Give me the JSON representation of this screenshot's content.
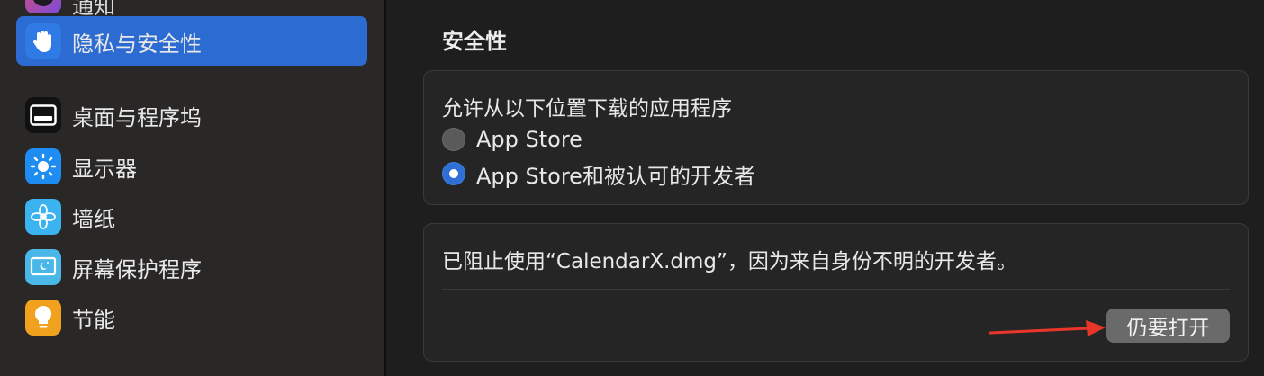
{
  "sidebar": {
    "partial_item": {
      "label": "通知",
      "icon": "focus-icon"
    },
    "items": [
      {
        "label": "隐私与安全性",
        "icon": "hand-raised-icon",
        "icon_bg": "#2f7ae5",
        "active": true
      },
      {
        "label": "桌面与程序坞",
        "icon": "dock-icon",
        "icon_bg": "#111111"
      },
      {
        "label": "显示器",
        "icon": "sun-icon",
        "icon_bg": "#1e8cf0"
      },
      {
        "label": "墙纸",
        "icon": "flower-icon",
        "icon_bg": "#3ab3f0"
      },
      {
        "label": "屏幕保护程序",
        "icon": "screensaver-icon",
        "icon_bg": "#49b8e8"
      },
      {
        "label": "节能",
        "icon": "lightbulb-icon",
        "icon_bg": "#f0a21e"
      }
    ]
  },
  "main": {
    "section_title": "安全性",
    "downloads_card": {
      "heading": "允许从以下位置下载的应用程序",
      "options": [
        {
          "label": "App Store",
          "selected": false
        },
        {
          "label": "App Store和被认可的开发者",
          "selected": true
        }
      ]
    },
    "blocked_card": {
      "message": "已阻止使用“CalendarX.dmg”，因为来自身份不明的开发者。",
      "open_button": "仍要打开"
    }
  },
  "annotation": {
    "arrow_color": "#e8362b"
  }
}
